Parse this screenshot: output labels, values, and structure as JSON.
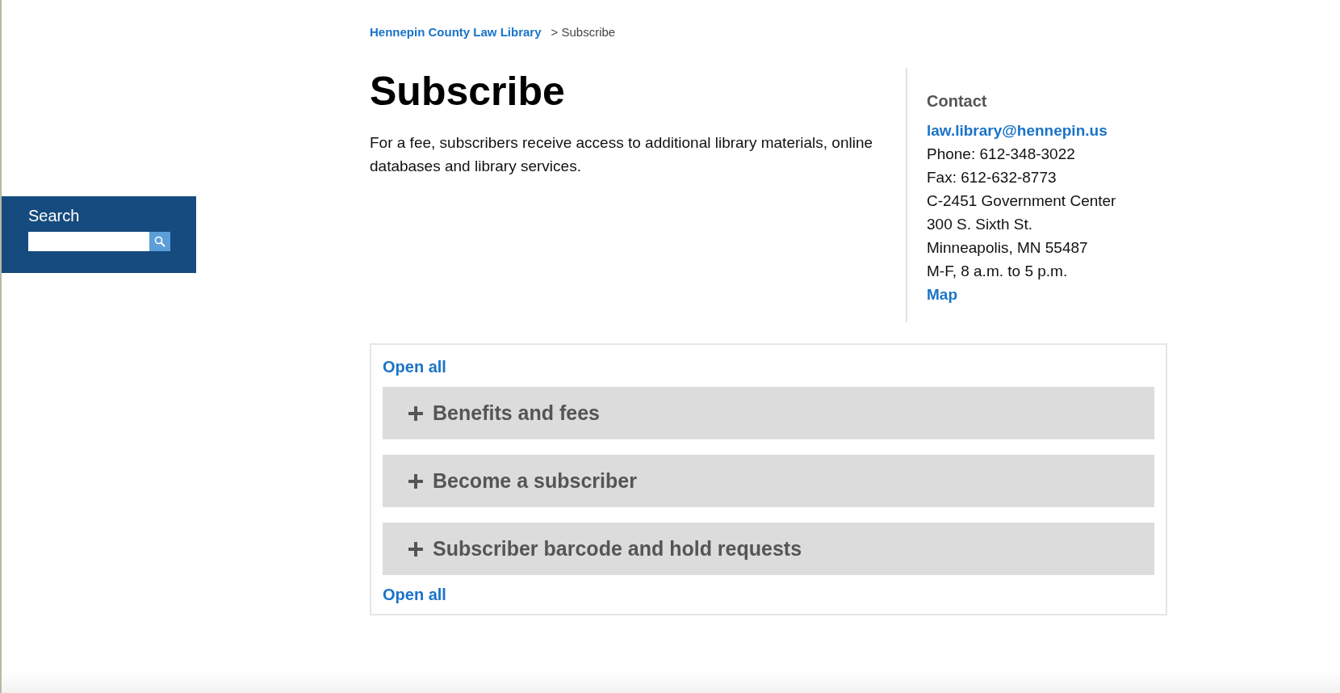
{
  "search": {
    "label": "Search"
  },
  "breadcrumb": {
    "link": "Hennepin County Law Library",
    "current": "> Subscribe"
  },
  "title": "Subscribe",
  "intro": "For a fee, subscribers receive access to additional library materials, online databases and library services.",
  "contact": {
    "heading": "Contact",
    "email": "law.library@hennepin.us",
    "lines": [
      "Phone: 612-348-3022",
      "Fax: 612-632-8773",
      "C-2451 Government Center",
      "300 S. Sixth St.",
      "Minneapolis, MN 55487",
      "M-F, 8 a.m. to 5 p.m."
    ],
    "map": "Map"
  },
  "accordion": {
    "open_all_top": "Open all",
    "items": [
      {
        "label": "Benefits and fees",
        "expanded": false
      },
      {
        "label": "Become a subscriber",
        "expanded": false
      },
      {
        "label": "Subscriber barcode and hold requests",
        "expanded": false
      }
    ],
    "open_all_bottom": "Open all"
  }
}
